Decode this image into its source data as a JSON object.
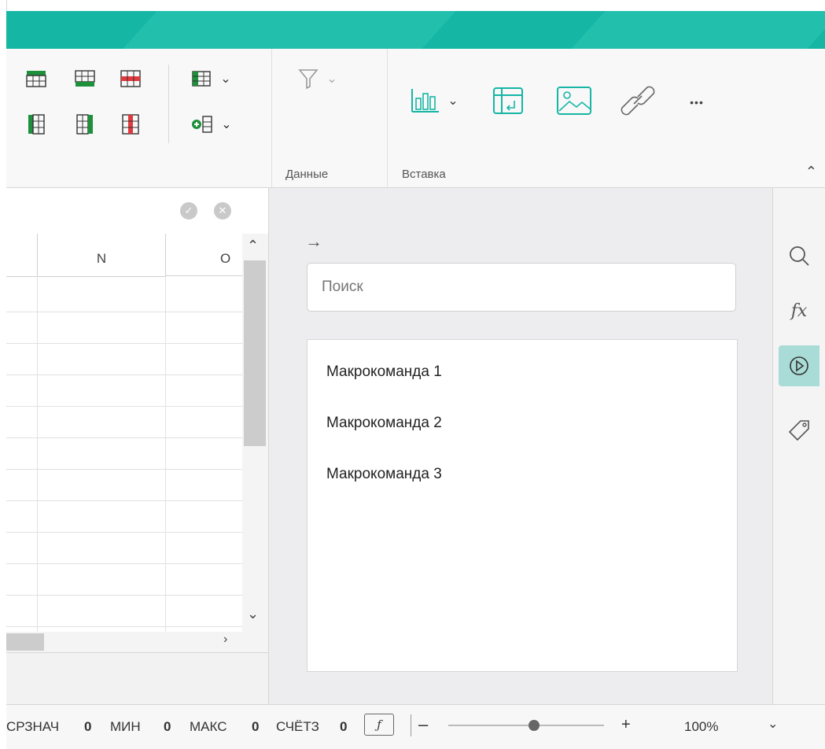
{
  "ribbon": {
    "groups": {
      "data_label": "Данные",
      "insert_label": "Вставка"
    },
    "more_label": "•••"
  },
  "formula_bar": {
    "confirm_label": "✓",
    "cancel_label": "✕"
  },
  "sheet": {
    "columns": [
      "N",
      "O"
    ]
  },
  "side_panel": {
    "search_placeholder": "Поиск",
    "macros": [
      "Макрокоманда 1",
      "Макрокоманда 2",
      "Макрокоманда 3"
    ]
  },
  "status_bar": {
    "avg_label": "СРЗНАЧ",
    "avg_value": "0",
    "min_label": "МИН",
    "min_value": "0",
    "max_label": "МАКС",
    "max_value": "0",
    "count_label": "СЧЁТЗ",
    "count_value": "0",
    "zoom_minus": "–",
    "zoom_plus": "+",
    "zoom_value": "100%",
    "zoom_level": 1.0
  },
  "colors": {
    "accent": "#15b6a4",
    "active_tool": "#a9dcd6",
    "green": "#1e8f3a",
    "red": "#e03a3e"
  }
}
